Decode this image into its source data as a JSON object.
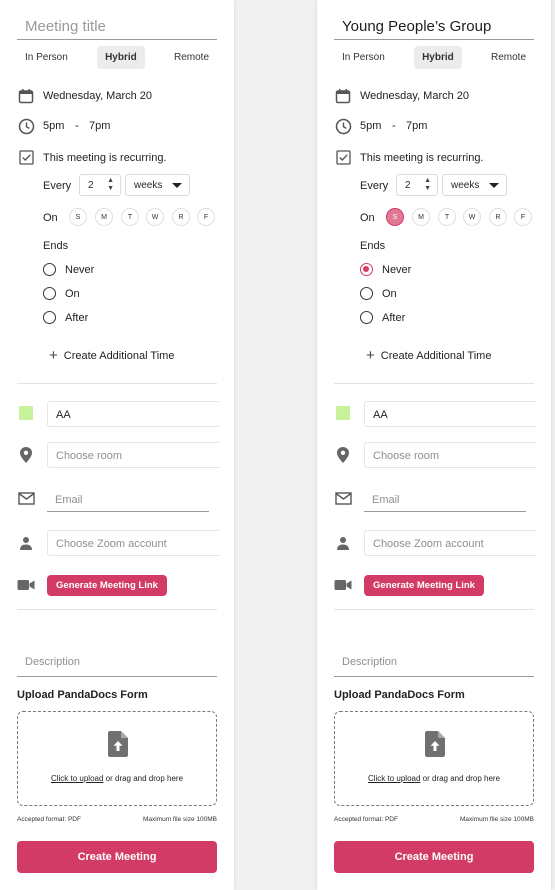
{
  "panels": [
    {
      "title": {
        "value": "",
        "placeholder": "Meeting title"
      },
      "modes": [
        "In Person",
        "Hybrid",
        "Remote"
      ],
      "active_mode": "Hybrid",
      "date": "Wednesday, March 20",
      "time": {
        "start": "5pm",
        "separator": "-",
        "end": "7pm"
      },
      "recurring_label": "This meeting is recurring.",
      "recurring_checked": true,
      "every_label": "Every",
      "every_value": "2",
      "every_unit": "weeks",
      "on_label": "On",
      "days": [
        "S",
        "M",
        "T",
        "W",
        "R",
        "F"
      ],
      "selected_days": [],
      "ends_label": "Ends",
      "ends_options": [
        "Never",
        "On",
        "After"
      ],
      "ends_selected": "",
      "add_time_label": "Create Additional Time",
      "color_value": "AA",
      "swatch_color": "#c7f29b",
      "room_placeholder": "Choose room",
      "email_placeholder": "Email",
      "zoom_placeholder": "Choose Zoom account",
      "generate_link_label": "Generate Meeting Link",
      "description_placeholder": "Description",
      "upload_title": "Upload PandaDocs Form",
      "upload_link": "Click to upload",
      "upload_hint": " or drag and drop here",
      "accepted_format": "Accepted format: PDF",
      "max_size": "Maximum file size 100MB",
      "create_label": "Create Meeting"
    },
    {
      "title": {
        "value": "Young People’s Group",
        "placeholder": ""
      },
      "modes": [
        "In Person",
        "Hybrid",
        "Remote"
      ],
      "active_mode": "Hybrid",
      "date": "Wednesday, March 20",
      "time": {
        "start": "5pm",
        "separator": "-",
        "end": "7pm"
      },
      "recurring_label": "This meeting is recurring.",
      "recurring_checked": true,
      "every_label": "Every",
      "every_value": "2",
      "every_unit": "weeks",
      "on_label": "On",
      "days": [
        "S",
        "M",
        "T",
        "W",
        "R",
        "F"
      ],
      "selected_days": [
        "S"
      ],
      "ends_label": "Ends",
      "ends_options": [
        "Never",
        "On",
        "After"
      ],
      "ends_selected": "Never",
      "add_time_label": "Create Additional Time",
      "color_value": "AA",
      "swatch_color": "#c7f29b",
      "room_placeholder": "Choose room",
      "email_placeholder": "Email",
      "zoom_placeholder": "Choose Zoom account",
      "generate_link_label": "Generate Meeting Link",
      "description_placeholder": "Description",
      "upload_title": "Upload PandaDocs Form",
      "upload_link": "Click to upload",
      "upload_hint": " or drag and drop here",
      "accepted_format": "Accepted format: PDF",
      "max_size": "Maximum file size 100MB",
      "create_label": "Create Meeting"
    }
  ],
  "colors": {
    "accent": "#d23b66",
    "accent_light": "#e07a94",
    "swatch": "#c7f29b"
  },
  "icons": [
    "calendar-icon",
    "clock-icon",
    "checkbox-checked-icon",
    "plus-icon",
    "location-pin-icon",
    "mail-icon",
    "person-icon",
    "video-camera-icon",
    "file-upload-icon"
  ]
}
